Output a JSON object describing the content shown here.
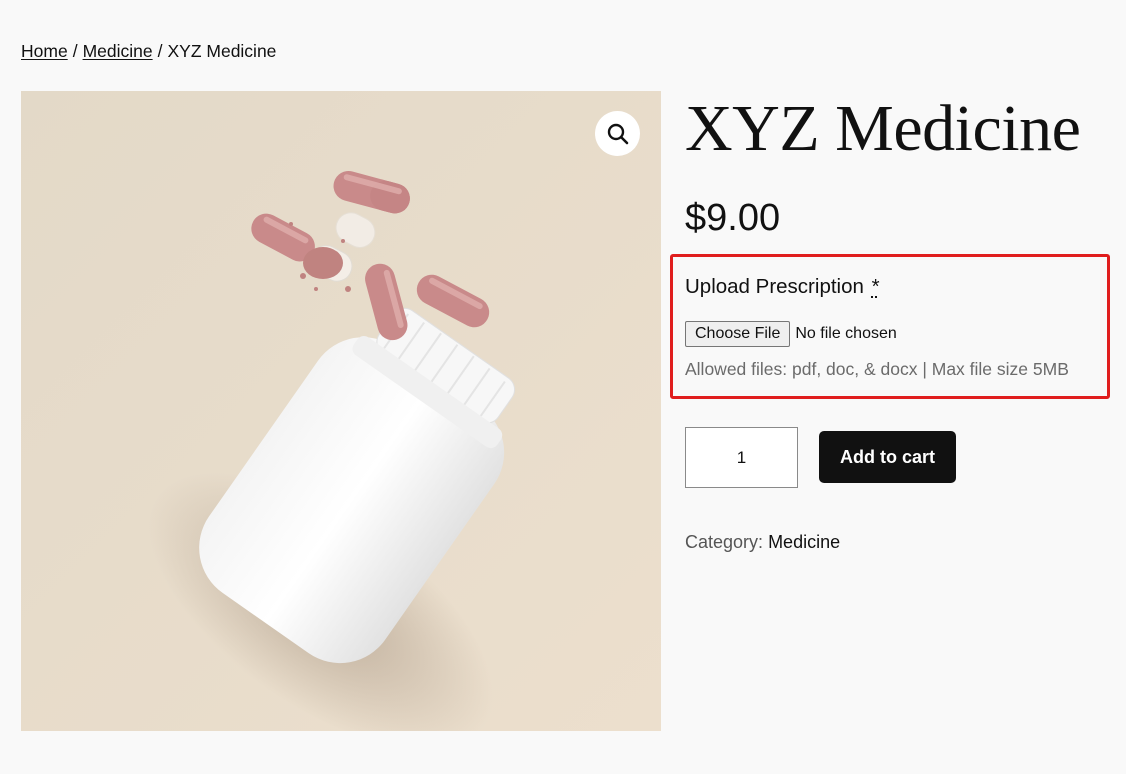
{
  "breadcrumb": {
    "home": "Home",
    "separator": "/",
    "category": "Medicine",
    "current": "XYZ Medicine"
  },
  "image": {
    "zoom_icon": "magnifier-icon",
    "background": "#e6dccb",
    "capsule_color": "#c98a8a",
    "bottle_color": "#ffffff"
  },
  "product": {
    "title": "XYZ Medicine",
    "price": "$9.00"
  },
  "upload": {
    "label": "Upload Prescription",
    "required_mark": "*",
    "button": "Choose File",
    "status": "No file chosen",
    "allowed": "Allowed files: pdf, doc, & docx | Max file size 5MB",
    "highlight_color": "#e01d1d"
  },
  "cart": {
    "quantity": "1",
    "add_label": "Add to cart"
  },
  "meta": {
    "category_label": "Category:",
    "category_value": "Medicine"
  }
}
